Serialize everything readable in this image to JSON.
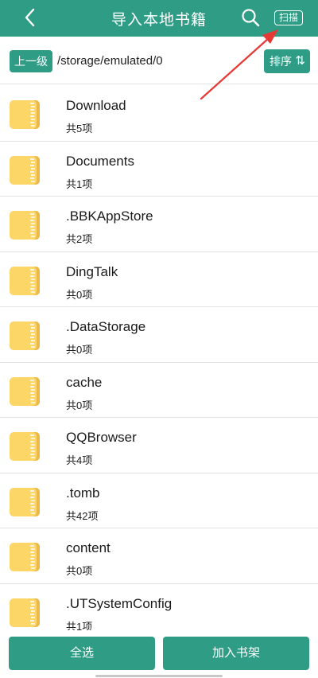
{
  "header": {
    "title": "导入本地书籍",
    "scan_label": "扫描"
  },
  "pathbar": {
    "up_label": "上一级",
    "path": "/storage/emulated/0",
    "sort_label": "排序",
    "sort_arrows": "⇅"
  },
  "folders": [
    {
      "name": "Download",
      "count": "共5项"
    },
    {
      "name": "Documents",
      "count": "共1项"
    },
    {
      "name": ".BBKAppStore",
      "count": "共2项"
    },
    {
      "name": "DingTalk",
      "count": "共0项"
    },
    {
      "name": ".DataStorage",
      "count": "共0项"
    },
    {
      "name": "cache",
      "count": "共0项"
    },
    {
      "name": "QQBrowser",
      "count": "共4项"
    },
    {
      "name": ".tomb",
      "count": "共42项"
    },
    {
      "name": "content",
      "count": "共0项"
    },
    {
      "name": ".UTSystemConfig",
      "count": "共1项"
    }
  ],
  "footer": {
    "select_all_label": "全选",
    "add_shelf_label": "加入书架"
  },
  "colors": {
    "accent": "#2f9d86",
    "folder": "#fcd667",
    "annotation_arrow": "#e53935"
  },
  "icons": [
    "back-arrow-icon",
    "search-icon",
    "folder-icon"
  ]
}
